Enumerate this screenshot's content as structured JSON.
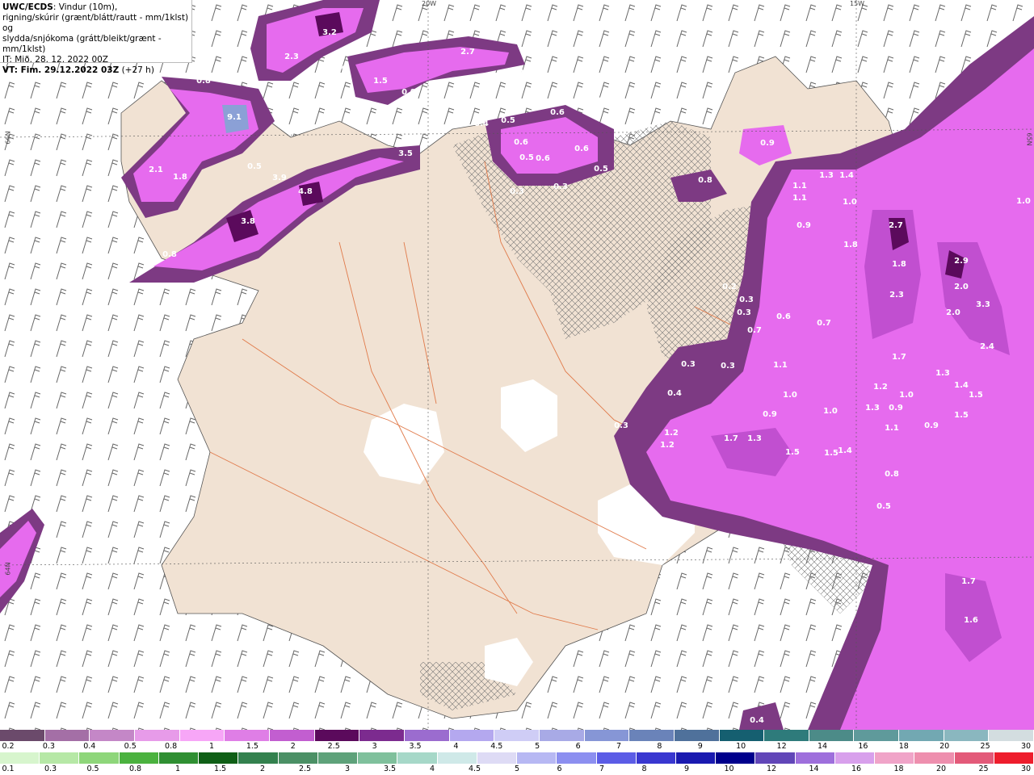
{
  "header": {
    "line1_bold": "UWC/ECDS",
    "line1_rest": ": Vindur (10m),",
    "line2": "rigning/skúrir (grænt/blátt/rautt - mm/1klst) og",
    "line3": "slydda/snjókoma (grátt/bleikt/grænt - mm/1klst)",
    "line4": "IT: Mið. 28. 12. 2022 00Z",
    "line5_bold": "VT: Fim. 29.12.2022 03Z",
    "line5_rest": " (+27 h)"
  },
  "coords": {
    "top_20w": "20W",
    "top_15w": "15W",
    "left_66n": "66N",
    "left_64n": "64N",
    "right_65n": "65N"
  },
  "precip_values": [
    "3.2",
    "0.5",
    "2.3",
    "1.0",
    "1.5",
    "0.9",
    "2.7",
    "0.2",
    "9.1",
    "0.8",
    "0.3",
    "0.3",
    "0.4",
    "0.5",
    "0.6",
    "0.6",
    "0.5",
    "0.6",
    "0.6",
    "0.5",
    "0.9",
    "2.1",
    "1.8",
    "0.5",
    "3.5",
    "3.9",
    "4.8",
    "3.8",
    "0.3",
    "0.3",
    "0.8",
    "0.8",
    "1.3",
    "1.4",
    "1.1",
    "1.1",
    "1.0",
    "0.9",
    "2.7",
    "1.8",
    "1.8",
    "2.9",
    "2.0",
    "3.3",
    "2.3",
    "2.0",
    "2.4",
    "0.2",
    "0.3",
    "0.3",
    "0.7",
    "0.6",
    "0.7",
    "0.3",
    "0.3",
    "1.1",
    "1.7",
    "1.0",
    "1.2",
    "1.0",
    "0.9",
    "1.3",
    "1.4",
    "1.5",
    "1.5",
    "1.3",
    "1.0",
    "0.9",
    "0.4",
    "0.3",
    "1.2",
    "1.2",
    "1.7",
    "1.3",
    "1.5",
    "1.5",
    "1.4",
    "1.1",
    "0.9",
    "0.8",
    "0.5",
    "1.7",
    "1.6",
    "0.4",
    "0.2",
    "1.0"
  ],
  "legend": {
    "row1_colors": [
      "#6b4a6b",
      "#a46fa6",
      "#c487c7",
      "#e79be9",
      "#f7a6f7",
      "#df7ee6",
      "#c25ed0",
      "#5b0a5c",
      "#7c2b8f",
      "#9b6ccf",
      "#b4a8ef",
      "#cfcdf6",
      "#a8aae6",
      "#8696d6",
      "#6a83b9",
      "#4f719b",
      "#155f70",
      "#2e7b7b",
      "#4c8b88",
      "#5f9a9b",
      "#72a8b2",
      "#8ab7bf",
      "#d3dde0"
    ],
    "row1_labels": [
      "0.2",
      "0.3",
      "0.4",
      "0.5",
      "0.8",
      "1",
      "1.5",
      "2",
      "2.5",
      "3",
      "3.5",
      "4",
      "4.5",
      "5",
      "6",
      "7",
      "8",
      "9",
      "10",
      "12",
      "14",
      "16",
      "18",
      "20",
      "25",
      "30"
    ],
    "row2_colors": [
      "#d7f5cd",
      "#b6e8a6",
      "#8ed67a",
      "#4bb23f",
      "#2f8f32",
      "#0f5f16",
      "#33814e",
      "#4b9065",
      "#5ea27a",
      "#7fc09c",
      "#a6d8c8",
      "#cfe9e8",
      "#dedbf5",
      "#b7b8f3",
      "#8c8ff0",
      "#5b5ce6",
      "#3937d0",
      "#1a1ab0",
      "#00008c",
      "#6146b8",
      "#9e6fdc",
      "#d8a0ec",
      "#f0a4c8",
      "#ee8fae",
      "#e35a79",
      "#ee1d2c"
    ],
    "row2_labels": [
      "0.1",
      "0.3",
      "0.5",
      "0.8",
      "1",
      "1.5",
      "2",
      "2.5",
      "3",
      "3.5",
      "4",
      "4.5",
      "5",
      "6",
      "7",
      "8",
      "9",
      "10",
      "12",
      "14",
      "16",
      "18",
      "20",
      "25",
      "30"
    ]
  }
}
